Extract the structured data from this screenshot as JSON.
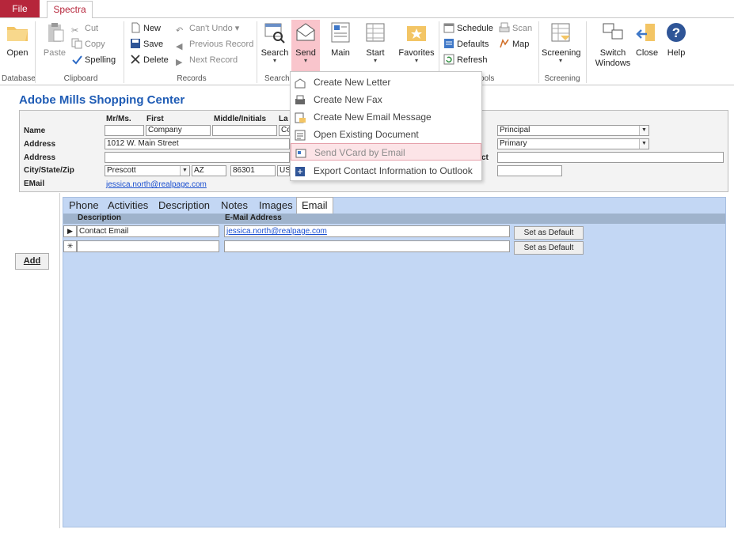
{
  "tabs": {
    "file": "File",
    "spectra": "Spectra"
  },
  "ribbon": {
    "database": {
      "open": "Open",
      "group": "Database"
    },
    "clipboard": {
      "paste": "Paste",
      "cut": "Cut",
      "copy": "Copy",
      "spelling": "Spelling",
      "group": "Clipboard"
    },
    "records": {
      "new": "New",
      "save": "Save",
      "delete": "Delete",
      "undo": "Can't Undo",
      "prev": "Previous Record",
      "next": "Next Record",
      "group": "Records"
    },
    "search": {
      "label": "Search",
      "group": "Search"
    },
    "send": {
      "label": "Send"
    },
    "main": {
      "label": "Main"
    },
    "start": {
      "label": "Start"
    },
    "favorites": {
      "label": "Favorites"
    },
    "tools": {
      "schedule": "Schedule",
      "scan": "Scan",
      "defaults": "Defaults",
      "map": "Map",
      "refresh": "Refresh",
      "group": "ools"
    },
    "screening": {
      "label": "Screening",
      "group": "Screening"
    },
    "switch_windows": "Switch\nWindows",
    "close": "Close",
    "help": "Help"
  },
  "send_menu": {
    "items": [
      "Create New Letter",
      "Create New Fax",
      "Create New Email Message",
      "Open Existing Document",
      "Send VCard by Email",
      "Export Contact Information to Outlook"
    ]
  },
  "form": {
    "title": "Adobe Mills Shopping Center",
    "col_labels": {
      "mr": "Mr/Ms.",
      "first": "First",
      "middle": "Middle/Initials",
      "last": "La"
    },
    "row_labels": {
      "name": "Name",
      "address1": "Address",
      "address2": "Address",
      "city": "City/State/Zip",
      "email": "EMail"
    },
    "values": {
      "first": "Company",
      "last": "Co",
      "address1": "1012 W. Main Street",
      "city": "Prescott",
      "state": "AZ",
      "zip": "86301",
      "country": "US",
      "email": "jessica.north@realpage.com",
      "role": "Principal",
      "type": "Primary",
      "ct_label": "ct"
    }
  },
  "subtabs": [
    "Phone",
    "Activities",
    "Description",
    "Notes",
    "Images",
    "Email"
  ],
  "email_grid": {
    "headers": {
      "description": "Description",
      "address": "E-Mail Address"
    },
    "rows": [
      {
        "description": "Contact Email",
        "address": "jessica.north@realpage.com",
        "button": "Set as Default"
      },
      {
        "description": "",
        "address": "",
        "button": "Set as Default"
      }
    ]
  },
  "add_button": "Add",
  "colors": {
    "accent": "#b6263b",
    "title": "#1f5cb5",
    "subform_bg": "#c3d7f4"
  }
}
